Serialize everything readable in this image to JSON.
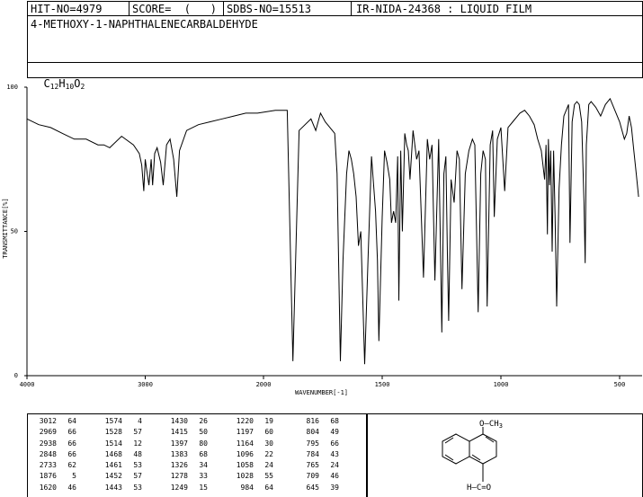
{
  "header": {
    "hit_no": "HIT-NO=4979",
    "score": "SCORE=  (   )",
    "sdbs_no": "SDBS-NO=15513",
    "ir_info": "IR-NIDA-24368 : LIQUID FILM",
    "compound": "4-METHOXY-1-NAPHTHALENECARBALDEHYDE",
    "formula": {
      "c": "C",
      "c_n": "12",
      "h": "H",
      "h_n": "10",
      "o": "O",
      "o_n": "2"
    }
  },
  "chart_data": {
    "type": "line",
    "xlabel": "WAVENUMBER[-1]",
    "ylabel": "TRANSMITTANCE[%]",
    "xlim": [
      4000,
      400
    ],
    "ylim": [
      0,
      100
    ],
    "x_ticks": [
      "4000",
      "3000",
      "2000",
      "1500",
      "1000",
      "500"
    ],
    "y_ticks": [
      "100",
      "50",
      "0"
    ],
    "x": [
      4000,
      3900,
      3800,
      3700,
      3600,
      3500,
      3400,
      3350,
      3300,
      3200,
      3100,
      3050,
      3030,
      3012,
      3000,
      2990,
      2969,
      2950,
      2938,
      2920,
      2900,
      2870,
      2848,
      2820,
      2790,
      2760,
      2733,
      2710,
      2650,
      2550,
      2450,
      2350,
      2250,
      2150,
      2050,
      1950,
      1900,
      1876,
      1850,
      1800,
      1780,
      1760,
      1740,
      1720,
      1700,
      1690,
      1676,
      1665,
      1650,
      1640,
      1630,
      1620,
      1610,
      1600,
      1590,
      1574,
      1560,
      1545,
      1528,
      1520,
      1514,
      1500,
      1490,
      1480,
      1468,
      1461,
      1452,
      1443,
      1435,
      1430,
      1422,
      1415,
      1405,
      1397,
      1390,
      1383,
      1370,
      1355,
      1345,
      1326,
      1310,
      1300,
      1290,
      1278,
      1262,
      1249,
      1240,
      1232,
      1225,
      1220,
      1210,
      1197,
      1185,
      1175,
      1164,
      1150,
      1135,
      1120,
      1110,
      1096,
      1085,
      1075,
      1065,
      1058,
      1045,
      1035,
      1028,
      1015,
      1000,
      984,
      970,
      950,
      920,
      900,
      880,
      860,
      845,
      830,
      816,
      810,
      804,
      800,
      795,
      790,
      784,
      778,
      772,
      765,
      755,
      745,
      735,
      725,
      715,
      709,
      700,
      690,
      680,
      670,
      660,
      650,
      645,
      640,
      630,
      620,
      600,
      580,
      560,
      540,
      520,
      500,
      480,
      470,
      460,
      450,
      440,
      430,
      420,
      410,
      400
    ],
    "y": [
      89,
      87,
      86,
      84,
      82,
      82,
      80,
      80,
      79,
      83,
      80,
      77,
      73,
      64,
      75,
      72,
      66,
      75,
      66,
      77,
      79,
      74,
      66,
      80,
      82,
      75,
      62,
      78,
      85,
      87,
      88,
      89,
      90,
      91,
      91,
      92,
      92,
      5,
      85,
      89,
      85,
      91,
      88,
      86,
      84,
      70,
      5,
      40,
      70,
      78,
      75,
      70,
      62,
      45,
      50,
      4,
      40,
      76,
      57,
      40,
      12,
      55,
      78,
      74,
      68,
      53,
      57,
      53,
      76,
      26,
      78,
      50,
      84,
      80,
      78,
      68,
      85,
      75,
      78,
      34,
      82,
      75,
      80,
      33,
      82,
      15,
      70,
      76,
      40,
      19,
      68,
      60,
      78,
      75,
      30,
      70,
      78,
      82,
      80,
      22,
      70,
      78,
      75,
      24,
      80,
      85,
      55,
      82,
      86,
      64,
      86,
      88,
      91,
      92,
      90,
      87,
      82,
      78,
      68,
      80,
      49,
      82,
      66,
      78,
      43,
      78,
      56,
      24,
      65,
      80,
      90,
      92,
      94,
      46,
      88,
      94,
      95,
      94,
      88,
      60,
      39,
      80,
      94,
      95,
      93,
      90,
      94,
      96,
      92,
      88,
      82,
      84,
      90,
      86,
      78,
      70,
      62
    ],
    "peak_table": [
      [
        [
          "3012",
          "64"
        ],
        [
          "1574",
          "4"
        ],
        [
          "1430",
          "26"
        ],
        [
          "1220",
          "19"
        ],
        [
          "816",
          "68"
        ]
      ],
      [
        [
          "2969",
          "66"
        ],
        [
          "1528",
          "57"
        ],
        [
          "1415",
          "50"
        ],
        [
          "1197",
          "60"
        ],
        [
          "804",
          "49"
        ]
      ],
      [
        [
          "2938",
          "66"
        ],
        [
          "1514",
          "12"
        ],
        [
          "1397",
          "80"
        ],
        [
          "1164",
          "30"
        ],
        [
          "795",
          "66"
        ]
      ],
      [
        [
          "2848",
          "66"
        ],
        [
          "1468",
          "48"
        ],
        [
          "1383",
          "68"
        ],
        [
          "1096",
          "22"
        ],
        [
          "784",
          "43"
        ]
      ],
      [
        [
          "2733",
          "62"
        ],
        [
          "1461",
          "53"
        ],
        [
          "1326",
          "34"
        ],
        [
          "1058",
          "24"
        ],
        [
          "765",
          "24"
        ]
      ],
      [
        [
          "1876",
          "5"
        ],
        [
          "1452",
          "57"
        ],
        [
          "1278",
          "33"
        ],
        [
          "1028",
          "55"
        ],
        [
          "709",
          "46"
        ]
      ],
      [
        [
          "1620",
          "46"
        ],
        [
          "1443",
          "53"
        ],
        [
          "1249",
          "15"
        ],
        [
          "984",
          "64"
        ],
        [
          "645",
          "39"
        ]
      ]
    ]
  },
  "structure": {
    "substituent_top": "O—CH",
    "substituent_top_sub": "3",
    "substituent_bottom": "H—C=O"
  },
  "colors": {
    "line": "#000000",
    "background": "#ffffff"
  }
}
